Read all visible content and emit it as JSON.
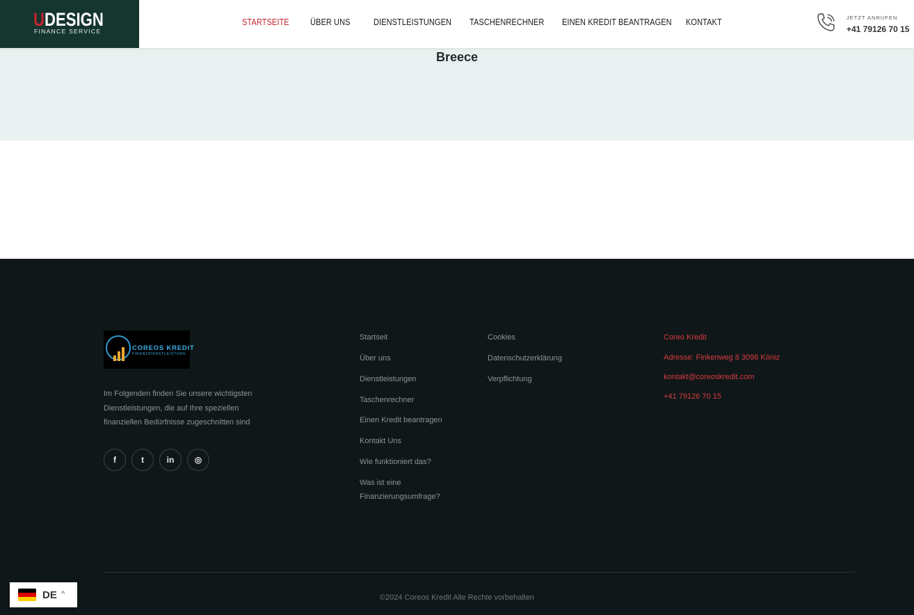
{
  "header": {
    "brand": {
      "first_letter": "U",
      "rest": "DESIGN",
      "subtitle": "FINANCE SERVICE"
    },
    "nav": [
      {
        "label": "STARTSEITE",
        "active": true
      },
      {
        "label": "ÜBER UNS",
        "active": false
      },
      {
        "label": "DIENSTLEISTUNGEN",
        "active": false
      },
      {
        "label": "TASCHENRECHNER",
        "active": false
      },
      {
        "label": "EINEN KREDIT BEANTRAGEN",
        "active": false
      },
      {
        "label": "KONTAKT",
        "active": false
      }
    ],
    "call": {
      "label": "JETZT ANRUFEN",
      "number": "+41 79126 70 15",
      "icon": "phone-icon"
    }
  },
  "hero": {
    "title": "Breece"
  },
  "footer": {
    "logo": {
      "title": "COREOS KREDIT",
      "subtitle": "FINANZDIENSTLEISTUNG"
    },
    "about": "Im Folgenden finden Sie unsere wichtigsten Dienstleistungen, die auf Ihre speziellen finanziellen Bedürfnisse zugeschnitten sind",
    "social": [
      {
        "icon": "facebook-icon",
        "glyph": "f"
      },
      {
        "icon": "twitter-icon",
        "glyph": "t"
      },
      {
        "icon": "linkedin-icon",
        "glyph": "in"
      },
      {
        "icon": "instagram-icon",
        "glyph": "◎"
      }
    ],
    "links_col1": [
      "Startseit",
      "Über uns",
      "Dienstleistungen",
      "Taschenrechner",
      "Einen Kredit beantragen",
      "Kontakt Uns",
      "Wie funktioniert das?",
      "Was ist eine Finanzierungsumfrage?"
    ],
    "links_col2": [
      "Cookies",
      "Datenschutzerklärung",
      "Verpflichtung"
    ],
    "contact": {
      "company": "Coreo Kredit",
      "address": "Adresse: Finkenweg 8 3098 Köniz",
      "email": "kontakt@coreoskredit.com",
      "phone": "+41 79126 70 15"
    },
    "copyright": "©2024 Coreos Kredit Alle Rechte vorbehalten"
  },
  "language": {
    "code": "DE",
    "flag": "germany-flag-icon"
  },
  "colors": {
    "accent_red": "#c6232f",
    "brand_green": "#15362f",
    "hero_bg": "#e9f1f0",
    "footer_bg": "#101719"
  }
}
